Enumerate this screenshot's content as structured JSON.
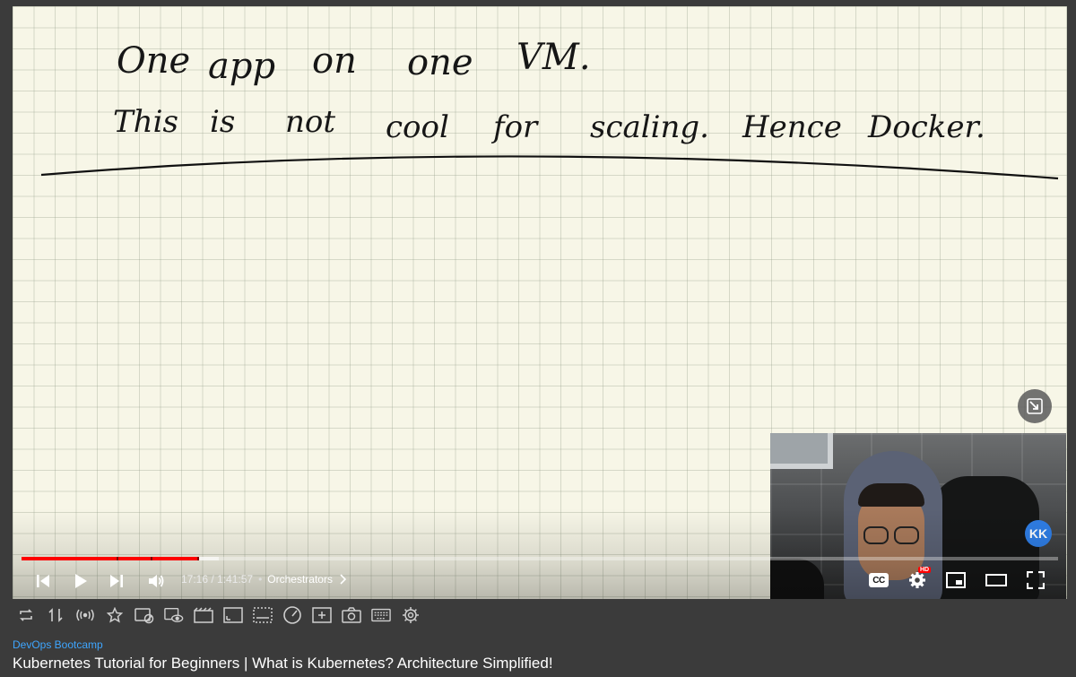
{
  "whiteboard": {
    "line1": [
      "One",
      "app",
      "on",
      "one",
      "VM."
    ],
    "line2": [
      "This",
      "is",
      "not",
      "cool",
      "for",
      "scaling.",
      "Hence",
      "Docker."
    ]
  },
  "overlay": {
    "badge_text": "KK"
  },
  "player": {
    "progress_fraction": 0.171,
    "time_display": "17:16 / 1:41:57",
    "separator": "•",
    "chapter": "Orchestrators",
    "hd_badge": "HD",
    "cc_label": "CC"
  },
  "video": {
    "channel": "DevOps Bootcamp",
    "title": "Kubernetes Tutorial for Beginners | What is Kubernetes? Architecture Simplified!"
  },
  "colors": {
    "progress": "#ff0000",
    "channel_link": "#3ea6ff",
    "badge": "#2f7ee6"
  },
  "toolbar_icons": [
    "loop-icon",
    "sort-icon",
    "broadcast-icon",
    "star-icon",
    "ads-off-icon",
    "view-icon",
    "cinema-icon",
    "screen-icon",
    "subtitle-bar-icon",
    "speed-icon",
    "add-icon",
    "camera-icon",
    "keyboard-icon",
    "settings-icon"
  ]
}
